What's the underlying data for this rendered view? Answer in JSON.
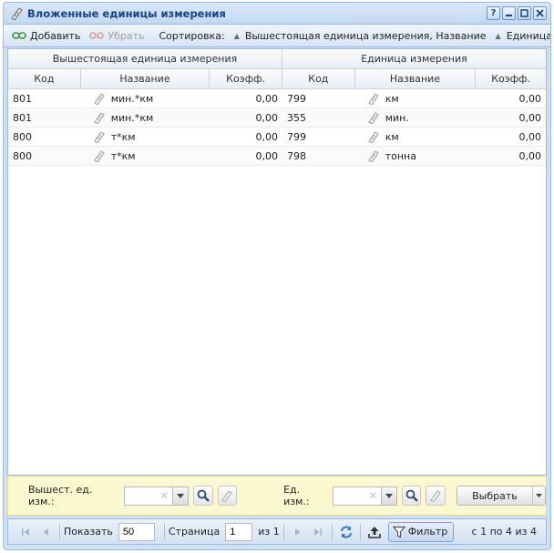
{
  "window": {
    "title": "Вложенные единицы измерения",
    "help_icon": "?"
  },
  "toolbar": {
    "add_label": "Добавить",
    "remove_label": "Убрать",
    "sort_label": "Сортировка:",
    "sort_item1": "Вышестоящая единица измерения, Название",
    "sort_item2": "Единица измер"
  },
  "grid": {
    "group1": "Вышестоящая единица измерения",
    "group2": "Единица измерения",
    "col_code": "Код",
    "col_name": "Название",
    "col_coef": "Коэфф.",
    "rows": [
      {
        "code1": "801",
        "name1": "мин.*км",
        "coef1": "0,00",
        "code2": "799",
        "name2": "км",
        "coef2": "0,00"
      },
      {
        "code1": "801",
        "name1": "мин.*км",
        "coef1": "0,00",
        "code2": "355",
        "name2": "мин.",
        "coef2": "0,00"
      },
      {
        "code1": "800",
        "name1": "т*км",
        "coef1": "0,00",
        "code2": "799",
        "name2": "км",
        "coef2": "0,00"
      },
      {
        "code1": "800",
        "name1": "т*км",
        "coef1": "0,00",
        "code2": "798",
        "name2": "тонна",
        "coef2": "0,00"
      }
    ]
  },
  "filter": {
    "parent_label": "Вышест. ед. изм.:",
    "unit_label": "Ед. изм.:",
    "select_button": "Выбрать"
  },
  "pager": {
    "show_label": "Показать",
    "page_size": "50",
    "page_label": "Страница",
    "page_value": "1",
    "of_label": "из 1",
    "filter_button": "Фильтр",
    "info": "с 1 по 4 из 4"
  }
}
